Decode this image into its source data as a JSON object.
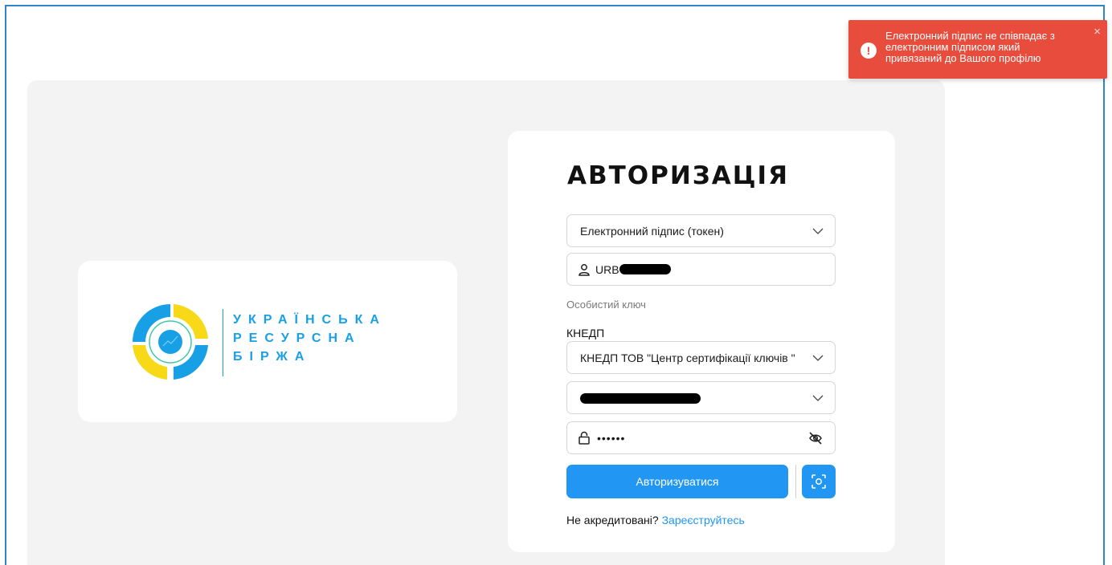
{
  "toast": {
    "message": "Електронний підпис не співпадає з електронним підписом який привязаний до Вашого профілю",
    "icon": "error-icon",
    "close_label": "×",
    "color": "#e84c3d"
  },
  "logo": {
    "line1": "УКРАЇНСЬКА",
    "line2": "РЕСУРСНА",
    "line3": "БІРЖА",
    "colors": {
      "blue": "#18a0e6",
      "yellow": "#f7d917"
    }
  },
  "auth": {
    "title": "АВТОРИЗАЦІЯ",
    "method_select": "Електронний підпис (токен)",
    "username_prefix": "URB",
    "key_label": "Особистий ключ",
    "kedp_label": "КНЕДП",
    "kedp_select": "КНЕДП ТОВ \"Центр сертифікації ключів \"",
    "password_mask": "••••••",
    "submit_label": "Авторизуватися",
    "register_prompt": "Не акредитовані?",
    "register_link": "Зареєструйтесь",
    "accent_color": "#2196f3"
  }
}
